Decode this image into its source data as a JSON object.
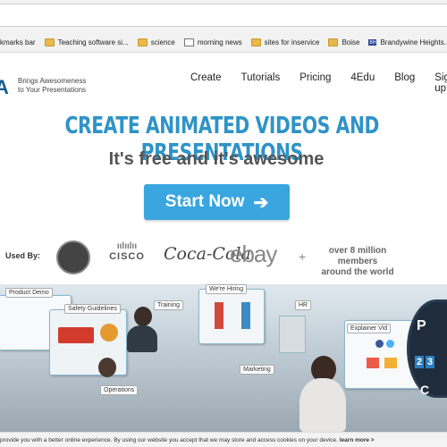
{
  "bookmarks": [
    {
      "label": "kmarks bar",
      "icon": "folder-icon"
    },
    {
      "label": "Teaching software si...",
      "icon": "folder-icon"
    },
    {
      "label": "science",
      "icon": "folder-icon"
    },
    {
      "label": "morning news",
      "icon": "page-icon"
    },
    {
      "label": "sites for inservice",
      "icon": "folder-icon"
    },
    {
      "label": "Boise",
      "icon": "folder-icon"
    },
    {
      "label": "Brandywine Heights...",
      "icon": "bhsd-icon"
    }
  ],
  "header": {
    "logo": "A",
    "tagline_1": "Brings Awesomeness",
    "tagline_2": "to Your Presentations",
    "nav": [
      "Create",
      "Tutorials",
      "Pricing",
      "4Edu",
      "Blog",
      "Sign up"
    ]
  },
  "hero": {
    "headline": "CREATE ANIMATED VIDEOS AND PRESENTATIONS",
    "subhead": "It's free and it's awesome",
    "cta": "Start Now",
    "cta_arrow": "➔"
  },
  "used_by": {
    "label": "Used By:",
    "brands": [
      "CISCO",
      "Coca-Cola",
      "ebay"
    ],
    "plus": "+",
    "members_1": "over 8 million members",
    "members_2": "around the world"
  },
  "banner": {
    "labels": [
      "Product Demo",
      "Safety Guidelines",
      "Training",
      "We're Hiring",
      "HR",
      "Marketing",
      "Operations",
      "Explainer Vid"
    ],
    "badge_letter": "P",
    "badge_digits": [
      "2",
      "3"
    ],
    "badge_bottom": "C"
  },
  "cookie": {
    "text": "provide you with a better online experience. By using our website you accept that we may store and access cookies on your device.",
    "link": "learn more >"
  },
  "colors": {
    "headline_blue": "#2f93c7",
    "cta_blue": "#3aa6e0"
  }
}
